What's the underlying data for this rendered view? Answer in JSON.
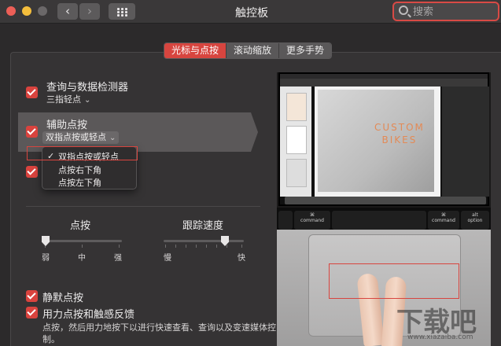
{
  "window": {
    "title": "触控板",
    "back_glyph": "‹",
    "forward_glyph": "›",
    "search_placeholder": "搜索"
  },
  "tabs": [
    {
      "label": "光标与点按",
      "active": true
    },
    {
      "label": "滚动缩放",
      "active": false
    },
    {
      "label": "更多手势",
      "active": false
    }
  ],
  "options": {
    "lookup": {
      "label": "查询与数据检测器",
      "sub": "三指轻点",
      "checked": true
    },
    "secondary_click": {
      "label": "辅助点按",
      "sub": "双指点按或轻点",
      "checked": true
    },
    "third_checked": true,
    "silent_click": {
      "label": "静默点按",
      "checked": true
    },
    "force_click": {
      "label": "用力点按和触感反馈",
      "checked": true,
      "description": "点按，然后用力地按下以进行快速查看、查询以及变速媒体控制。"
    }
  },
  "dropdown": {
    "check_glyph": "✓",
    "items": [
      "双指点按或轻点",
      "点按右下角",
      "点按左下角"
    ],
    "selected_index": 0
  },
  "sliders": {
    "click": {
      "label": "点按",
      "ticks": [
        "弱",
        "中",
        "强"
      ],
      "value": 0.0
    },
    "tracking": {
      "label": "跟踪速度",
      "ticks": [
        "慢",
        "快"
      ],
      "value": 0.75
    }
  },
  "preview": {
    "doc_title_line1": "CUSTOM",
    "doc_title_line2": "BIKES",
    "keys": [
      "⌘",
      "command",
      "⌘",
      "command",
      "alt",
      "option"
    ]
  },
  "watermark": {
    "main": "下载吧",
    "sub": "www.xiazaiba.com"
  },
  "colors": {
    "accent": "#d7453f",
    "background": "#2c2a2b",
    "panel": "#353334"
  }
}
